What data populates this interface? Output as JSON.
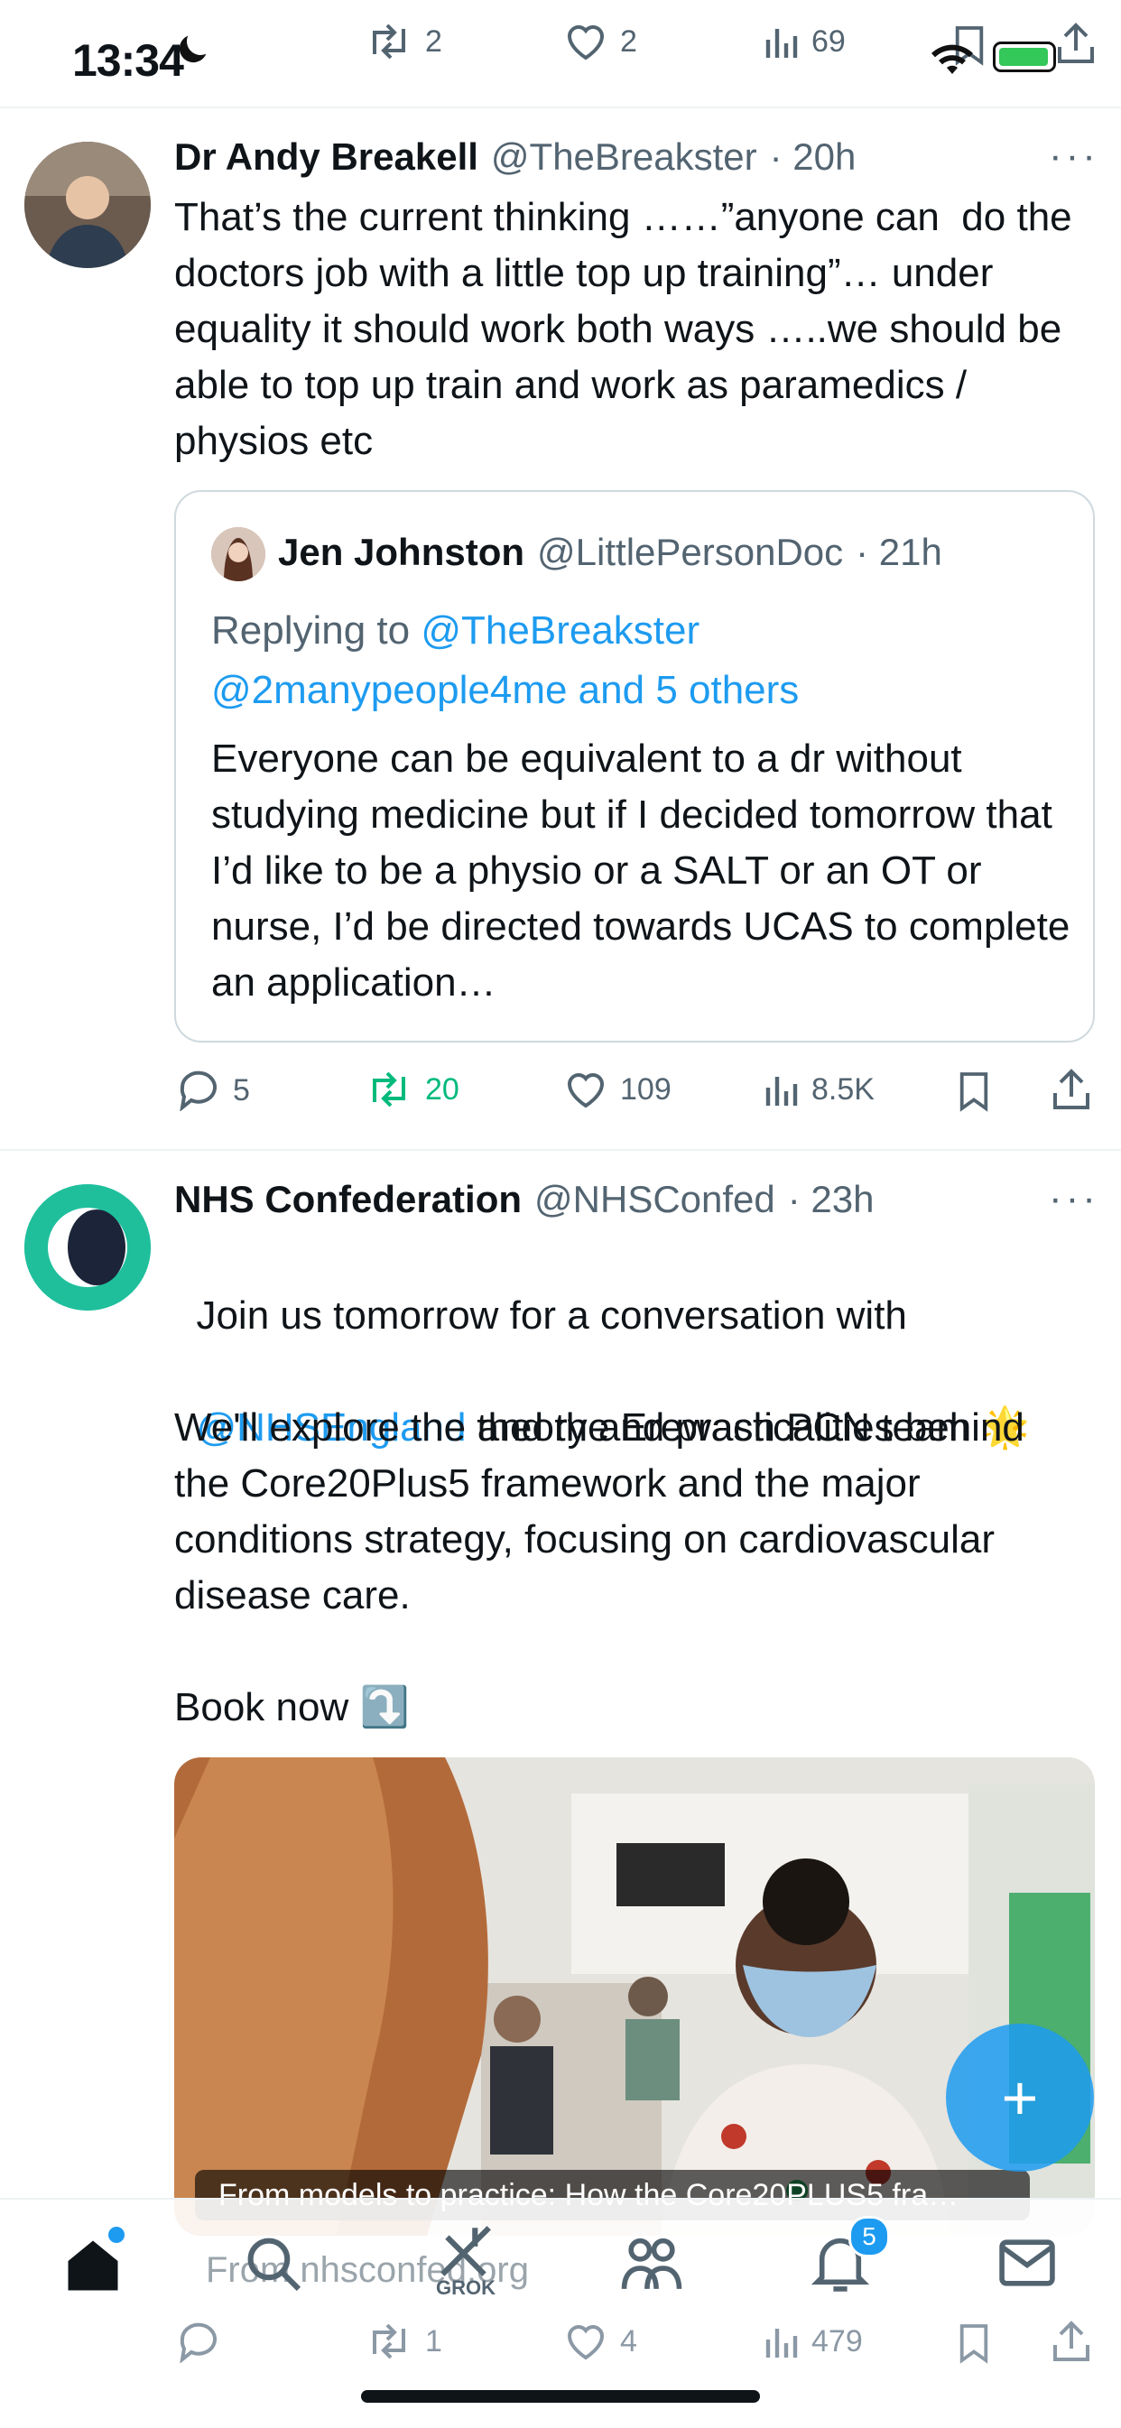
{
  "status": {
    "time": "13:34"
  },
  "top_actions": {
    "retweets": "2",
    "likes": "2",
    "views": "69"
  },
  "tweet1": {
    "name": "Dr Andy Breakell",
    "handle": "@TheBreakster",
    "time": "· 20h",
    "text": "That’s the current thinking ……”anyone can  do the doctors job with a little top up training”… under equality it should work both ways …..we should be able to top up train and work as paramedics / physios etc",
    "quote": {
      "name": "Jen Johnston",
      "handle": "@LittlePersonDoc",
      "time": "· 21h",
      "replying_prefix": "Replying to ",
      "replying_user": "@TheBreakster",
      "replying_line2": "@2manypeople4me and 5 others",
      "text": "Everyone can be equivalent to a dr without studying medicine but if I decided tomorrow that I’d like to be a physio or a SALT or an OT or nurse, I’d be directed towards UCAS to complete an application…"
    },
    "actions": {
      "replies": "5",
      "retweets": "20",
      "likes": "109",
      "views": "8.5K"
    }
  },
  "tweet2": {
    "name": "NHS Confederation",
    "handle": "@NHSConfed",
    "time": "· 23h",
    "line1": "Join us tomorrow for a conversation with",
    "mention": "@NHSEngland",
    "line2_rest": " and the Erewash PCN team 🌟",
    "para2": "We'll explore the theory and practicalities behind the Core20Plus5 framework and the major conditions strategy, focusing on cardiovascular disease care.",
    "book_now": "Book now ⤵️",
    "card_caption": "From models to practice: How the Core20PLUS5 fra…",
    "card_source": "From nhsconfed.org",
    "actions": {
      "replies": "",
      "retweets": "1",
      "likes": "4",
      "views": "479"
    }
  },
  "tabbar": {
    "grok_label": "GROK",
    "notifications_badge": "5"
  },
  "colors": {
    "accent": "#1d9bf0",
    "retweet_green": "#00ba7c",
    "muted": "#536471",
    "nhs_teal": "#1abc9c"
  }
}
